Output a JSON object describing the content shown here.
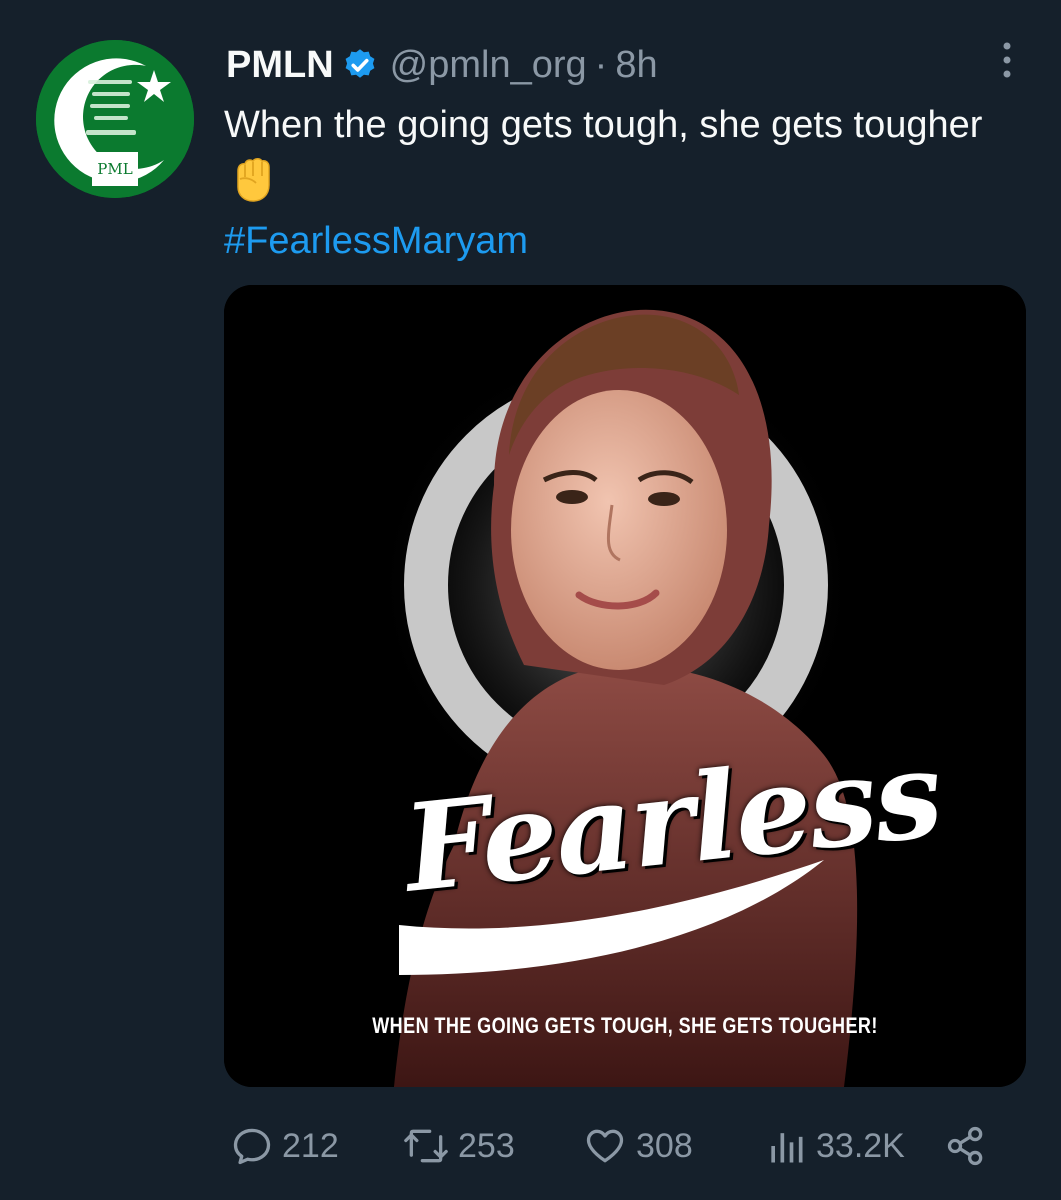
{
  "tweet": {
    "author_name": "PMLN",
    "handle": "@pmln_org",
    "separator": "·",
    "time": "8h",
    "text": "When the going gets tough, she gets tougher",
    "emoji": "raised-fist",
    "hashtag": "#FearlessMaryam",
    "verified": true
  },
  "avatar": {
    "logo_text": "PML",
    "background": "#0b7a2f"
  },
  "media": {
    "headline": "Fearless",
    "caption": "WHEN THE GOING GETS TOUGH, SHE GETS TOUGHER!"
  },
  "actions": {
    "replies": "212",
    "retweets": "253",
    "likes": "308",
    "views": "33.2K"
  },
  "colors": {
    "background": "#15202b",
    "text": "#f7f9f9",
    "muted": "#8b98a5",
    "accent": "#1d9bf0"
  },
  "icons": [
    "verified-badge-icon",
    "more-options-icon",
    "reply-icon",
    "retweet-icon",
    "like-icon",
    "views-icon",
    "share-icon",
    "raised-fist-icon"
  ]
}
